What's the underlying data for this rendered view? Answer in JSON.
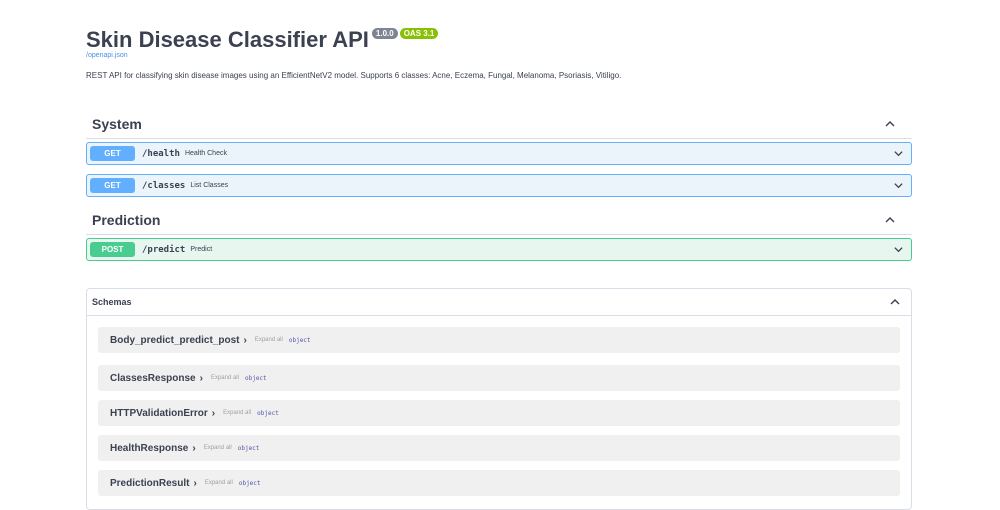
{
  "header": {
    "title": "Skin Disease Classifier API",
    "version": "1.0.0",
    "oas": "OAS 3.1",
    "spec_link": "/openapi.json",
    "description": "REST API for classifying skin disease images using an EfficientNetV2 model. Supports 6 classes: Acne, Eczema, Fungal, Melanoma, Psoriasis, Vitiligo."
  },
  "sections": [
    {
      "title": "System",
      "operations": [
        {
          "method": "GET",
          "path": "/health",
          "summary": "Health Check"
        },
        {
          "method": "GET",
          "path": "/classes",
          "summary": "List Classes"
        }
      ]
    },
    {
      "title": "Prediction",
      "operations": [
        {
          "method": "POST",
          "path": "/predict",
          "summary": "Predict"
        }
      ]
    }
  ],
  "schemas": {
    "title": "Schemas",
    "expand_label": "Expand all",
    "models": [
      {
        "name": "Body_predict_predict_post",
        "type": "object"
      },
      {
        "name": "ClassesResponse",
        "type": "object"
      },
      {
        "name": "HTTPValidationError",
        "type": "object"
      },
      {
        "name": "HealthResponse",
        "type": "object"
      },
      {
        "name": "PredictionResult",
        "type": "object"
      }
    ]
  },
  "colors": {
    "get": "#61affe",
    "post": "#49cc90",
    "version_badge": "#7d8492",
    "oas_badge": "#89bf04",
    "link": "#4990e2"
  },
  "icons": {
    "section_toggle": "chevron-up-icon",
    "operation_toggle": "chevron-down-icon",
    "model_toggle": "chevron-right-icon"
  }
}
